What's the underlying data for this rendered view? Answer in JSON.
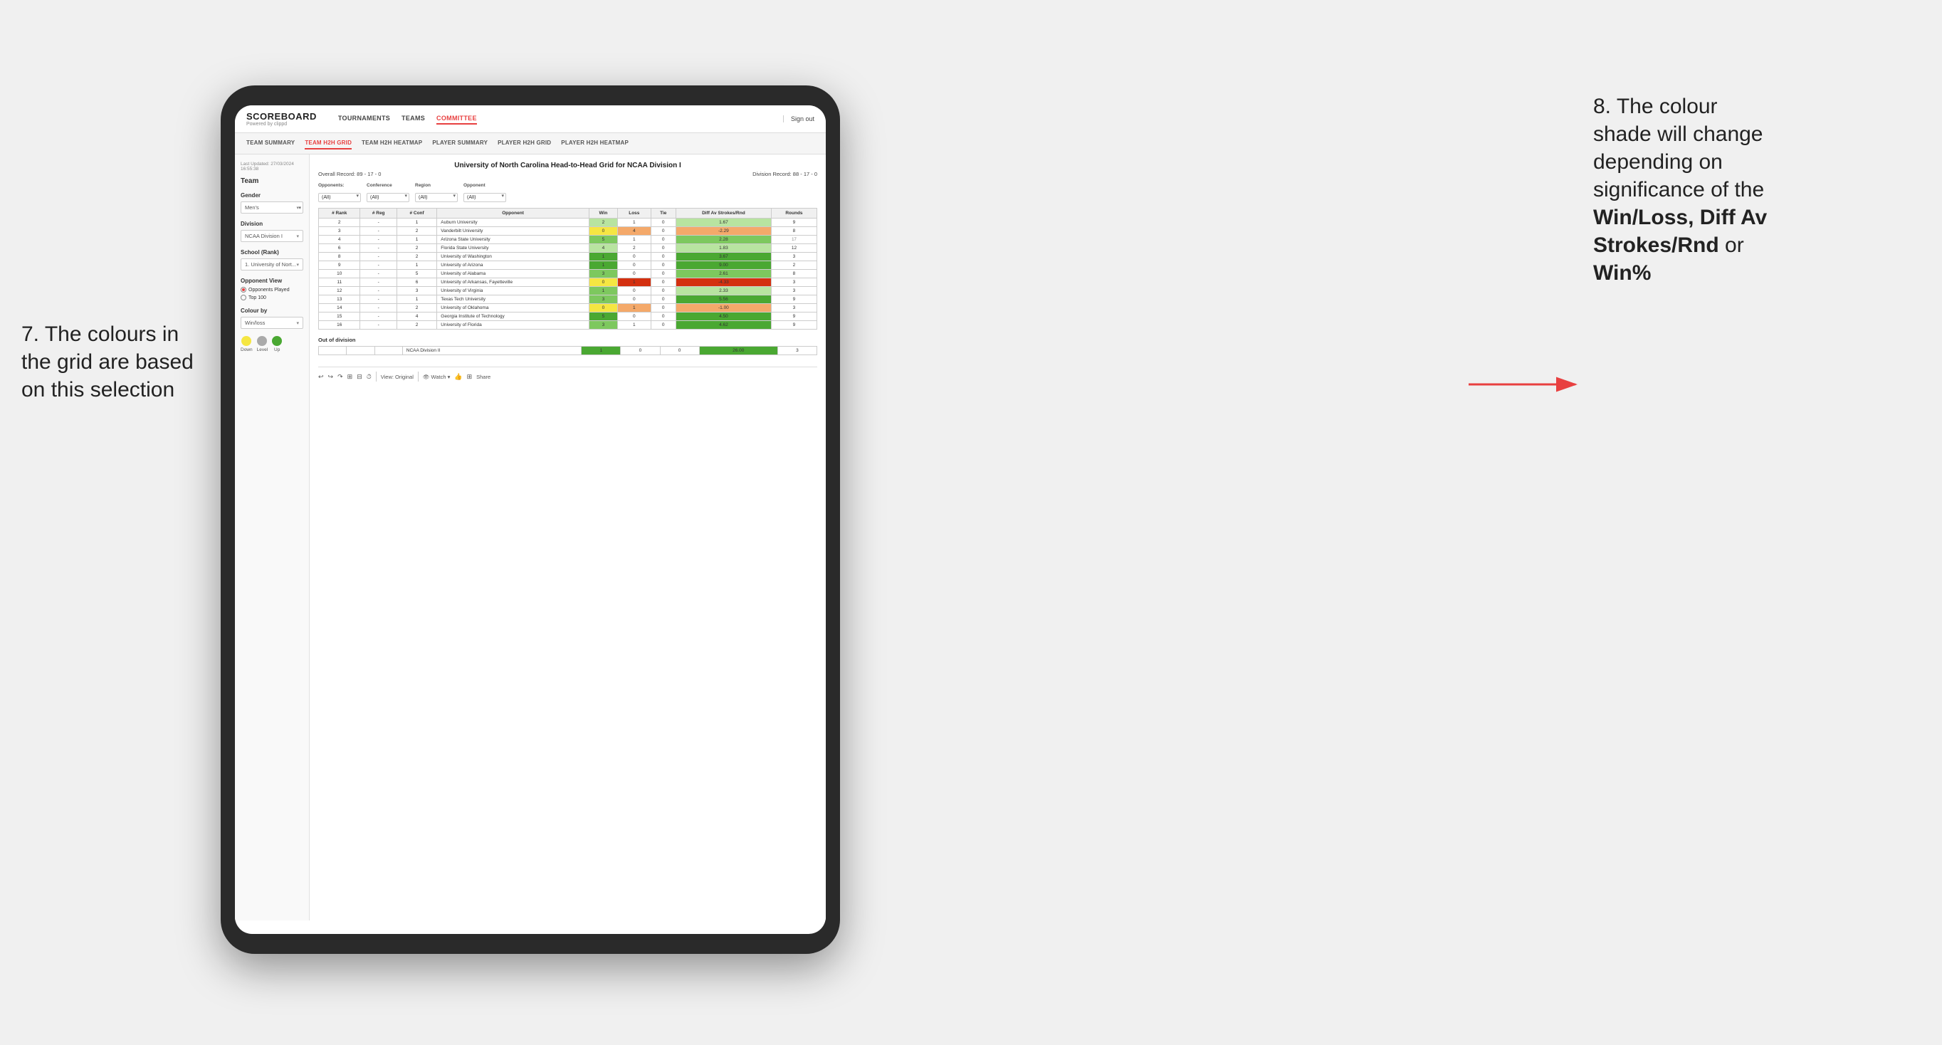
{
  "annotations": {
    "left": {
      "line1": "7. The colours in",
      "line2": "the grid are based",
      "line3": "on this selection"
    },
    "right": {
      "line1": "8. The colour",
      "line2": "shade will change",
      "line3": "depending on",
      "line4": "significance of the",
      "bold1": "Win/Loss",
      "comma": ", ",
      "bold2": "Diff Av",
      "line5": "Strokes/Rnd",
      "line6": " or",
      "bold3": "Win%"
    }
  },
  "nav": {
    "logo": "SCOREBOARD",
    "logo_sub": "Powered by clippd",
    "links": [
      "TOURNAMENTS",
      "TEAMS",
      "COMMITTEE"
    ],
    "sign_out": "Sign out"
  },
  "sub_nav": {
    "links": [
      "TEAM SUMMARY",
      "TEAM H2H GRID",
      "TEAM H2H HEATMAP",
      "PLAYER SUMMARY",
      "PLAYER H2H GRID",
      "PLAYER H2H HEATMAP"
    ]
  },
  "left_panel": {
    "last_updated_label": "Last Updated: 27/03/2024",
    "last_updated_time": "16:55:38",
    "team_label": "Team",
    "gender_label": "Gender",
    "gender_value": "Men's",
    "division_label": "Division",
    "division_value": "NCAA Division I",
    "school_label": "School (Rank)",
    "school_value": "1. University of Nort...",
    "opponent_view_label": "Opponent View",
    "radio_opponents": "Opponents Played",
    "radio_top100": "Top 100",
    "colour_by_label": "Colour by",
    "colour_by_value": "Win/loss",
    "legend_down": "Down",
    "legend_level": "Level",
    "legend_up": "Up",
    "legend_colors": {
      "down": "#f5e642",
      "level": "#aaaaaa",
      "up": "#4aa832"
    }
  },
  "grid": {
    "title": "University of North Carolina Head-to-Head Grid for NCAA Division I",
    "overall_record": "Overall Record: 89 - 17 - 0",
    "division_record": "Division Record: 88 - 17 - 0",
    "filters": {
      "opponents_label": "Opponents:",
      "opponents_value": "(All)",
      "conference_label": "Conference",
      "conference_value": "(All)",
      "region_label": "Region",
      "region_value": "(All)",
      "opponent_label": "Opponent",
      "opponent_value": "(All)"
    },
    "columns": [
      "#\nRank",
      "#\nReg",
      "#\nConf",
      "Opponent",
      "Win",
      "Loss",
      "Tie",
      "Diff Av\nStrokes/Rnd",
      "Rounds"
    ],
    "rows": [
      {
        "rank": "2",
        "reg": "-",
        "conf": "1",
        "opponent": "Auburn University",
        "win": "2",
        "loss": "1",
        "tie": "0",
        "diff": "1.67",
        "rounds": "9",
        "win_color": "cell-green-light",
        "loss_color": "cell-neutral",
        "diff_color": "cell-green-light"
      },
      {
        "rank": "3",
        "reg": "-",
        "conf": "2",
        "opponent": "Vanderbilt University",
        "win": "0",
        "loss": "4",
        "tie": "0",
        "diff": "-2.29",
        "rounds": "8",
        "win_color": "cell-yellow",
        "loss_color": "cell-red-light",
        "diff_color": "cell-red-light"
      },
      {
        "rank": "4",
        "reg": "-",
        "conf": "1",
        "opponent": "Arizona State University",
        "win": "5",
        "loss": "1",
        "tie": "0",
        "diff": "2.28",
        "rounds": "",
        "win_color": "cell-green-mid",
        "loss_color": "cell-neutral",
        "diff_color": "cell-green-mid",
        "extra": "17"
      },
      {
        "rank": "6",
        "reg": "-",
        "conf": "2",
        "opponent": "Florida State University",
        "win": "4",
        "loss": "2",
        "tie": "0",
        "diff": "1.83",
        "rounds": "12",
        "win_color": "cell-green-light",
        "loss_color": "cell-neutral",
        "diff_color": "cell-green-light"
      },
      {
        "rank": "8",
        "reg": "-",
        "conf": "2",
        "opponent": "University of Washington",
        "win": "1",
        "loss": "0",
        "tie": "0",
        "diff": "3.67",
        "rounds": "3",
        "win_color": "cell-green-dark",
        "loss_color": "cell-neutral",
        "diff_color": "cell-green-dark"
      },
      {
        "rank": "9",
        "reg": "-",
        "conf": "1",
        "opponent": "University of Arizona",
        "win": "1",
        "loss": "0",
        "tie": "0",
        "diff": "9.00",
        "rounds": "2",
        "win_color": "cell-green-dark",
        "loss_color": "cell-neutral",
        "diff_color": "cell-green-dark"
      },
      {
        "rank": "10",
        "reg": "-",
        "conf": "5",
        "opponent": "University of Alabama",
        "win": "3",
        "loss": "0",
        "tie": "0",
        "diff": "2.61",
        "rounds": "8",
        "win_color": "cell-green-mid",
        "loss_color": "cell-neutral",
        "diff_color": "cell-green-mid"
      },
      {
        "rank": "11",
        "reg": "-",
        "conf": "6",
        "opponent": "University of Arkansas, Fayetteville",
        "win": "0",
        "loss": "1",
        "tie": "0",
        "diff": "-4.33",
        "rounds": "3",
        "win_color": "cell-yellow",
        "loss_color": "cell-red-dark",
        "diff_color": "cell-red-dark"
      },
      {
        "rank": "12",
        "reg": "-",
        "conf": "3",
        "opponent": "University of Virginia",
        "win": "1",
        "loss": "0",
        "tie": "0",
        "diff": "2.33",
        "rounds": "3",
        "win_color": "cell-green-mid",
        "loss_color": "cell-neutral",
        "diff_color": "cell-green-light"
      },
      {
        "rank": "13",
        "reg": "-",
        "conf": "1",
        "opponent": "Texas Tech University",
        "win": "3",
        "loss": "0",
        "tie": "0",
        "diff": "5.56",
        "rounds": "9",
        "win_color": "cell-green-mid",
        "loss_color": "cell-neutral",
        "diff_color": "cell-green-dark"
      },
      {
        "rank": "14",
        "reg": "-",
        "conf": "2",
        "opponent": "University of Oklahoma",
        "win": "0",
        "loss": "1",
        "tie": "0",
        "diff": "-1.00",
        "rounds": "3",
        "win_color": "cell-yellow",
        "loss_color": "cell-red-light",
        "diff_color": "cell-red-light"
      },
      {
        "rank": "15",
        "reg": "-",
        "conf": "4",
        "opponent": "Georgia Institute of Technology",
        "win": "5",
        "loss": "0",
        "tie": "0",
        "diff": "4.50",
        "rounds": "9",
        "win_color": "cell-green-dark",
        "loss_color": "cell-neutral",
        "diff_color": "cell-green-dark"
      },
      {
        "rank": "16",
        "reg": "-",
        "conf": "2",
        "opponent": "University of Florida",
        "win": "3",
        "loss": "1",
        "tie": "0",
        "diff": "4.62",
        "rounds": "9",
        "win_color": "cell-green-mid",
        "loss_color": "cell-neutral",
        "diff_color": "cell-green-dark"
      }
    ],
    "out_of_division_label": "Out of division",
    "out_of_division_row": {
      "opponent": "NCAA Division II",
      "win": "1",
      "loss": "0",
      "tie": "0",
      "diff": "26.00",
      "rounds": "3",
      "win_color": "cell-green-dark",
      "diff_color": "cell-green-dark"
    }
  },
  "toolbar": {
    "view_label": "View: Original",
    "watch_label": "Watch ▾",
    "share_label": "Share"
  }
}
